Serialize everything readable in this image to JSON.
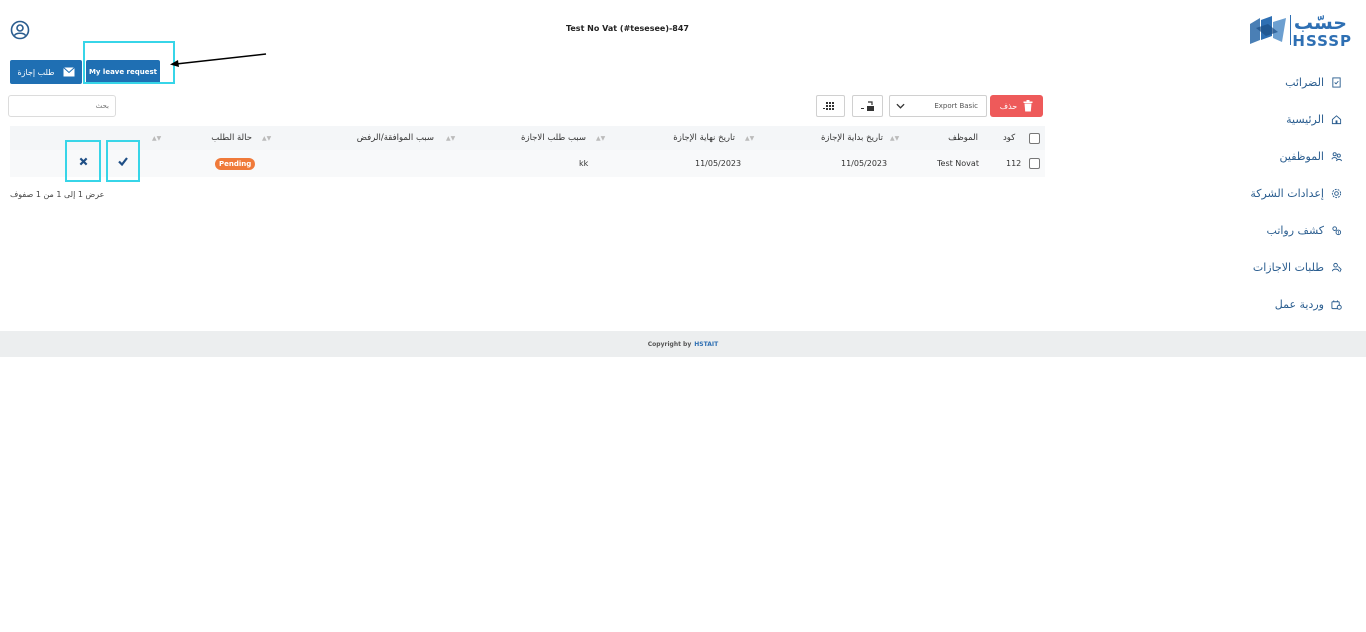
{
  "header": {
    "title": "Test No Vat (#tesesee)-847"
  },
  "brand": {
    "logo_arabic": "حسّب",
    "logo_latin": "HSSSP"
  },
  "sidebar": {
    "items": [
      {
        "label": "الضرائب",
        "icon": "tax-icon"
      },
      {
        "label": "الرئيسية",
        "icon": "home-icon"
      },
      {
        "label": "الموظفين",
        "icon": "employees-icon"
      },
      {
        "label": "إعدادات الشركة",
        "icon": "company-settings-icon"
      },
      {
        "label": "كشف رواتب",
        "icon": "payroll-icon"
      },
      {
        "label": "طلبات الاجازات",
        "icon": "leave-requests-icon"
      },
      {
        "label": "وردية عمل",
        "icon": "work-shift-icon"
      }
    ]
  },
  "actions": {
    "leave_request": "طلب إجازة",
    "my_leave_request": "My leave request"
  },
  "search": {
    "placeholder": "بحث"
  },
  "toolbar": {
    "delete": "حذف",
    "export": "Export Basic"
  },
  "table": {
    "columns": [
      "كود",
      "الموظف",
      "تاريخ بداية الإجازة",
      "تاريخ نهاية الإجازة",
      "سبب طلب الاجازة",
      "سبب الموافقة/الرفض",
      "حالة الطلب"
    ],
    "rows": [
      {
        "code": "112",
        "employee": "Test Novat",
        "start": "11/05/2023",
        "end": "11/05/2023",
        "reason": "kk",
        "decision_reason": "",
        "status": "Pending"
      }
    ],
    "info": "عرض 1 إلى 1 من 1 صفوف"
  },
  "footer": {
    "prefix": "Copyright by",
    "brand": "HSTAIT"
  },
  "colors": {
    "primary": "#1f6fb3",
    "danger": "#ee5a5a",
    "pending": "#f07a3a",
    "highlight": "#37d5e8"
  }
}
